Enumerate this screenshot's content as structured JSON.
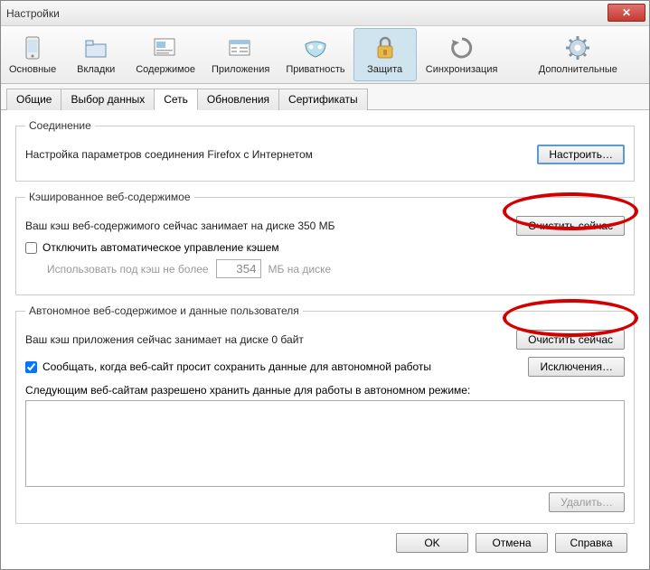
{
  "titlebar": {
    "title": "Настройки",
    "close": "X"
  },
  "toolbar": [
    {
      "label": "Основные",
      "icon": "basic"
    },
    {
      "label": "Вкладки",
      "icon": "tabs"
    },
    {
      "label": "Содержимое",
      "icon": "content"
    },
    {
      "label": "Приложения",
      "icon": "apps"
    },
    {
      "label": "Приватность",
      "icon": "privacy"
    },
    {
      "label": "Защита",
      "icon": "security",
      "selected": true
    },
    {
      "label": "Синхронизация",
      "icon": "sync"
    },
    {
      "label": "Дополнительные",
      "icon": "advanced"
    }
  ],
  "subtabs": [
    {
      "label": "Общие"
    },
    {
      "label": "Выбор данных"
    },
    {
      "label": "Сеть",
      "active": true
    },
    {
      "label": "Обновления"
    },
    {
      "label": "Сертификаты"
    }
  ],
  "connection": {
    "legend": "Соединение",
    "text": "Настройка параметров соединения Firefox с Интернетом",
    "button": "Настроить…"
  },
  "cache": {
    "legend": "Кэшированное веб-содержимое",
    "text": "Ваш кэш веб-содержимого сейчас занимает на диске 350 МБ",
    "button": "Очистить сейчас",
    "checkbox": "Отключить автоматическое управление кэшем",
    "limit_text_prefix": "Использовать под кэш не более",
    "limit_value": "354",
    "limit_suffix": "МБ на диске"
  },
  "offline": {
    "legend": "Автономное веб-содержимое и данные пользователя",
    "text": "Ваш кэш приложения сейчас занимает на диске 0 байт",
    "button_clear": "Очистить сейчас",
    "checkbox": "Сообщать, когда веб-сайт просит сохранить данные для автономной работы",
    "button_exceptions": "Исключения…",
    "list_label": "Следующим веб-сайтам разрешено хранить данные для работы в автономном режиме:",
    "button_delete": "Удалить…"
  },
  "dialog": {
    "ok": "OK",
    "cancel": "Отмена",
    "help": "Справка"
  }
}
